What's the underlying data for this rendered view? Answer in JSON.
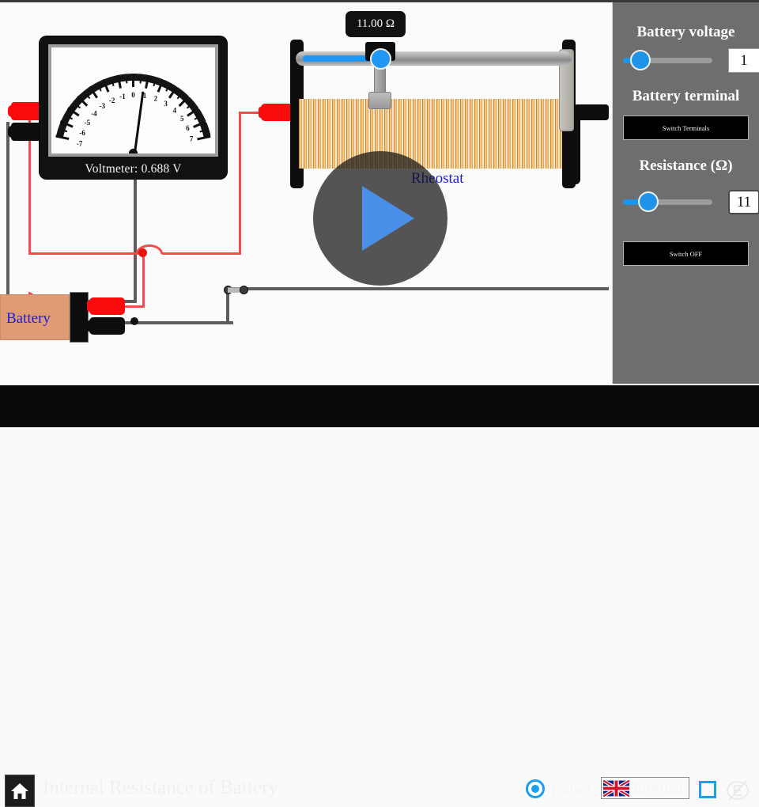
{
  "app": {
    "title": "Internal Resistance of Battery"
  },
  "stage": {
    "voltmeter": {
      "label": "Voltmeter: 0.688 V",
      "reading_value": 0.688,
      "unit": "V",
      "scale_min": -7,
      "scale_max": 7,
      "tick_labels": [
        "-7",
        "-6",
        "-5",
        "-4",
        "-3",
        "-2",
        "-1",
        "0",
        "1",
        "2",
        "3",
        "4",
        "5",
        "6",
        "7"
      ],
      "needle_value": 0.688
    },
    "rheostat": {
      "badge": "11.00 Ω",
      "label": "Rheostat",
      "value": 11.0,
      "slider_fraction": 0.27
    },
    "battery": {
      "label": "Battery"
    },
    "switch": {
      "state": "closed"
    },
    "play_overlay": {
      "name": "play"
    }
  },
  "sidebar": {
    "battery_voltage": {
      "heading": "Battery voltage",
      "value": "1",
      "fill_fraction": 0.1
    },
    "battery_terminal": {
      "heading": "Battery terminal",
      "button_label": "Switch Terminals"
    },
    "resistance": {
      "heading": "Resistance (Ω)",
      "value": "11",
      "fill_fraction": 0.22
    },
    "switch_button": {
      "label": "Switch OFF"
    }
  },
  "bottom_bar": {
    "home_icon": "home-icon",
    "title": "Internal Resistance of Battery",
    "label_toggle": {
      "text": "Label",
      "checked": true
    },
    "language": {
      "text": "English",
      "flag": "uk-flag-icon"
    },
    "fullscreen_icon": "fullscreen-icon",
    "logo_icon": "logo-disabled-icon"
  },
  "colors": {
    "accent_blue": "#1e93e8",
    "sidebar_bg": "#6e6e6e",
    "wire_red": "#f44b4b",
    "wire_black": "#5d5d5d",
    "coil_copper": "#e2a95c",
    "battery_body": "#e09b75",
    "label_blue": "#1a1ae0"
  }
}
